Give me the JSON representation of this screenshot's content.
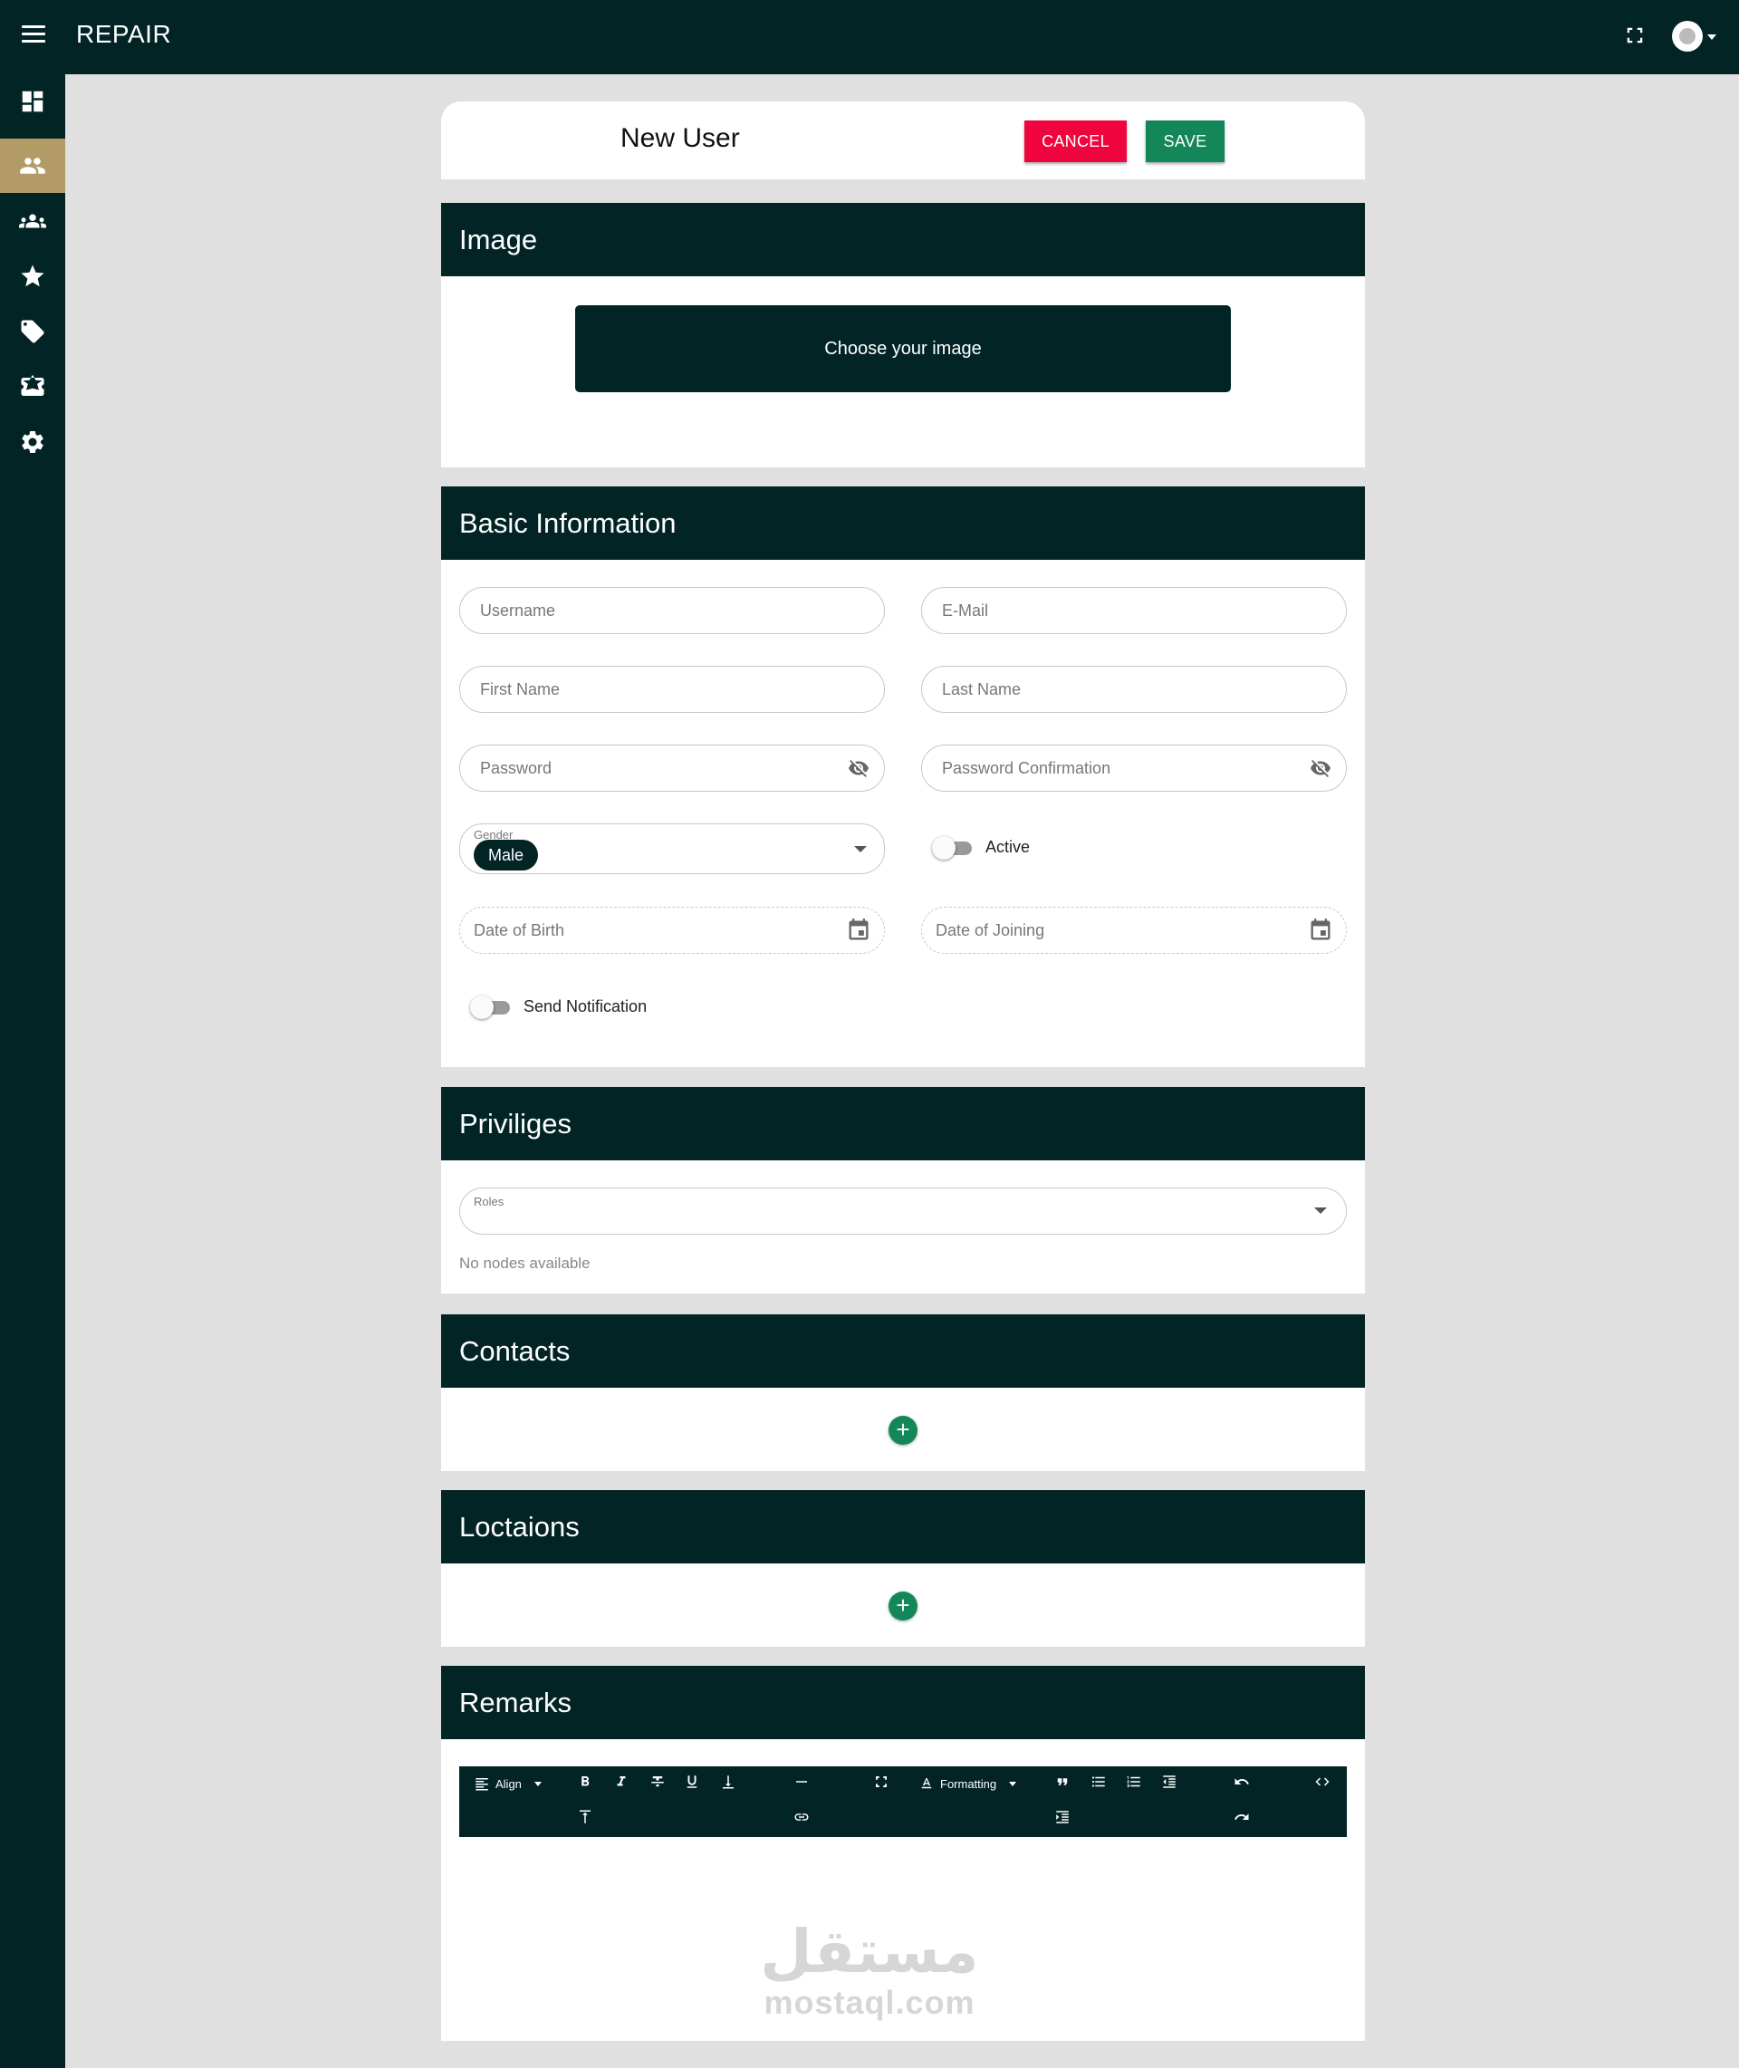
{
  "app": {
    "brand": "REPAIR"
  },
  "sidebar": {
    "items": [
      {
        "icon": "dashboard-icon",
        "active": false
      },
      {
        "icon": "users-icon",
        "active": true
      },
      {
        "icon": "groups-icon",
        "active": false
      },
      {
        "icon": "star-icon",
        "active": false
      },
      {
        "icon": "tag-icon",
        "active": false
      },
      {
        "icon": "ticket-icon",
        "active": false
      },
      {
        "icon": "gear-icon",
        "active": false
      }
    ]
  },
  "header": {
    "title": "New User",
    "cancel_label": "CANCEL",
    "save_label": "SAVE"
  },
  "image_section": {
    "title": "Image",
    "choose_label": "Choose your image"
  },
  "basic": {
    "title": "Basic Information",
    "username_placeholder": "Username",
    "email_placeholder": "E-Mail",
    "first_name_placeholder": "First Name",
    "last_name_placeholder": "Last Name",
    "password_placeholder": "Password",
    "password_confirm_placeholder": "Password Confirmation",
    "gender_label": "Gender",
    "gender_value": "Male",
    "active_label": "Active",
    "active_on": false,
    "dob_placeholder": "Date of Birth",
    "doj_placeholder": "Date of Joining",
    "notify_label": "Send Notification",
    "notify_on": false
  },
  "privileges": {
    "title": "Priviliges",
    "roles_label": "Roles",
    "empty_text": "No nodes available"
  },
  "contacts": {
    "title": "Contacts",
    "add_label": "+"
  },
  "locations": {
    "title": "Loctaions",
    "add_label": "+"
  },
  "remarks": {
    "title": "Remarks",
    "align_label": "Align",
    "formatting_label": "Formatting"
  },
  "watermark": {
    "logo": "مستقل",
    "url": "mostaql.com"
  },
  "colors": {
    "dark": "#032425",
    "accent": "#b39b68",
    "cancel": "#f0043d",
    "save": "#14875a",
    "background": "#e0e0e0"
  }
}
